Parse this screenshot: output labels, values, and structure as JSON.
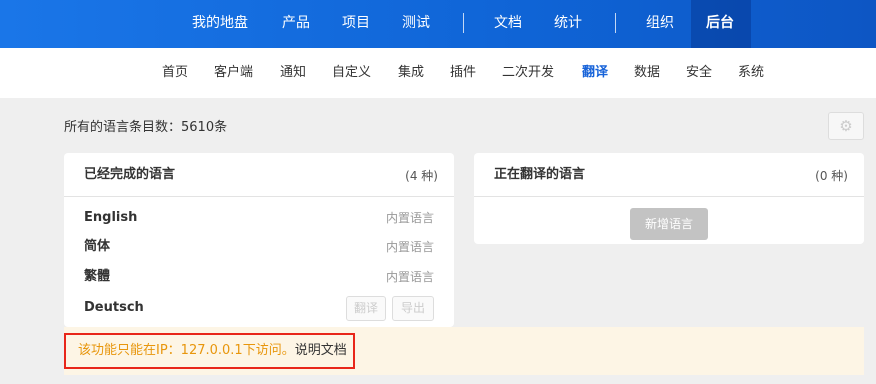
{
  "top_nav": {
    "items": [
      "我的地盘",
      "产品",
      "项目",
      "测试",
      "文档",
      "统计",
      "组织",
      "后台"
    ],
    "active": "后台"
  },
  "sub_nav": {
    "items": [
      "首页",
      "客户端",
      "通知",
      "自定义",
      "集成",
      "插件",
      "二次开发",
      "翻译",
      "数据",
      "安全",
      "系统"
    ],
    "active": "翻译"
  },
  "summary": {
    "label": "所有的语言条目数：5610条"
  },
  "settings_icon": "gear-icon",
  "completed_panel": {
    "title": "已经完成的语言",
    "count": "(4 种)",
    "languages": [
      {
        "name": "English",
        "tag": "内置语言"
      },
      {
        "name": "简体",
        "tag": "内置语言"
      },
      {
        "name": "繁體",
        "tag": "内置语言"
      },
      {
        "name": "Deutsch",
        "translate_button": "翻译",
        "export_button": "导出"
      }
    ]
  },
  "translating_panel": {
    "title": "正在翻译的语言",
    "count": "(0 种)",
    "add_button": "新增语言"
  },
  "notice": {
    "message": "该功能只能在IP：127.0.0.1下访问。",
    "link": "说明文档",
    "border_color": "#e8261a",
    "text_color": "#e8960c"
  },
  "colors": {
    "brand_blue": "#1a76e8",
    "active_tab": "#1763d9"
  }
}
